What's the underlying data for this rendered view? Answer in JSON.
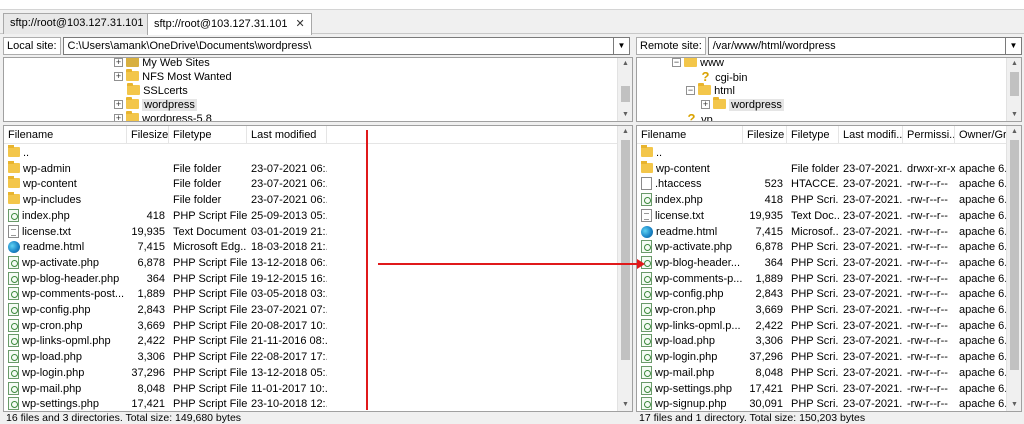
{
  "tabs": [
    {
      "label": "sftp://root@103.127.31.101",
      "active": false
    },
    {
      "label": "sftp://root@103.127.31.101",
      "active": true
    }
  ],
  "local": {
    "site_label": "Local site:",
    "path": "C:\\Users\\amank\\OneDrive\\Documents\\wordpress\\",
    "tree": [
      {
        "label": "My Web Sites",
        "icon": "special-folder-icon"
      },
      {
        "label": "NFS Most Wanted",
        "icon": "folder-icon"
      },
      {
        "label": "SSLcerts",
        "icon": "folder-icon"
      },
      {
        "label": "wordpress",
        "icon": "folder-icon"
      },
      {
        "label": "wordpress-5.8",
        "icon": "folder-icon"
      }
    ],
    "columns": [
      "Filename",
      "Filesize",
      "Filetype",
      "Last modified"
    ],
    "files": [
      {
        "name": "..",
        "size": "",
        "type": "",
        "modified": "",
        "icon": "folder"
      },
      {
        "name": "wp-admin",
        "size": "",
        "type": "File folder",
        "modified": "23-07-2021 06:...",
        "icon": "folder"
      },
      {
        "name": "wp-content",
        "size": "",
        "type": "File folder",
        "modified": "23-07-2021 06:...",
        "icon": "folder"
      },
      {
        "name": "wp-includes",
        "size": "",
        "type": "File folder",
        "modified": "23-07-2021 06:...",
        "icon": "folder"
      },
      {
        "name": "index.php",
        "size": "418",
        "type": "PHP Script File",
        "modified": "25-09-2013 05:...",
        "icon": "php"
      },
      {
        "name": "license.txt",
        "size": "19,935",
        "type": "Text Document",
        "modified": "03-01-2019 21:...",
        "icon": "txt"
      },
      {
        "name": "readme.html",
        "size": "7,415",
        "type": "Microsoft Edg...",
        "modified": "18-03-2018 21:...",
        "icon": "edge"
      },
      {
        "name": "wp-activate.php",
        "size": "6,878",
        "type": "PHP Script File",
        "modified": "13-12-2018 06:...",
        "icon": "php"
      },
      {
        "name": "wp-blog-header.php",
        "size": "364",
        "type": "PHP Script File",
        "modified": "19-12-2015 16:...",
        "icon": "php"
      },
      {
        "name": "wp-comments-post...",
        "size": "1,889",
        "type": "PHP Script File",
        "modified": "03-05-2018 03:...",
        "icon": "php"
      },
      {
        "name": "wp-config.php",
        "size": "2,843",
        "type": "PHP Script File",
        "modified": "23-07-2021 07:...",
        "icon": "php"
      },
      {
        "name": "wp-cron.php",
        "size": "3,669",
        "type": "PHP Script File",
        "modified": "20-08-2017 10:...",
        "icon": "php"
      },
      {
        "name": "wp-links-opml.php",
        "size": "2,422",
        "type": "PHP Script File",
        "modified": "21-11-2016 08:...",
        "icon": "php"
      },
      {
        "name": "wp-load.php",
        "size": "3,306",
        "type": "PHP Script File",
        "modified": "22-08-2017 17:...",
        "icon": "php"
      },
      {
        "name": "wp-login.php",
        "size": "37,296",
        "type": "PHP Script File",
        "modified": "13-12-2018 05:...",
        "icon": "php"
      },
      {
        "name": "wp-mail.php",
        "size": "8,048",
        "type": "PHP Script File",
        "modified": "11-01-2017 10:...",
        "icon": "php"
      },
      {
        "name": "wp-settings.php",
        "size": "17,421",
        "type": "PHP Script File",
        "modified": "23-10-2018 12:...",
        "icon": "php"
      }
    ],
    "status": "16 files and 3 directories. Total size: 149,680 bytes"
  },
  "remote": {
    "site_label": "Remote site:",
    "path": "/var/www/html/wordpress",
    "tree": [
      {
        "label": "www",
        "icon": "folder-icon"
      },
      {
        "label": "cgi-bin",
        "icon": "unknown-folder-icon"
      },
      {
        "label": "html",
        "icon": "folder-icon"
      },
      {
        "label": "wordpress",
        "icon": "folder-icon"
      },
      {
        "label": "vp",
        "icon": "unknown-folder-icon"
      }
    ],
    "columns": [
      "Filename",
      "Filesize",
      "Filetype",
      "Last modifi...",
      "Permissi...",
      "Owner/Gr..."
    ],
    "files": [
      {
        "name": "..",
        "size": "",
        "type": "",
        "modified": "",
        "perms": "",
        "owner": "",
        "icon": "folder"
      },
      {
        "name": "wp-content",
        "size": "",
        "type": "File folder",
        "modified": "23-07-2021...",
        "perms": "drwxr-xr-x",
        "owner": "apache 6...",
        "icon": "folder"
      },
      {
        "name": ".htaccess",
        "size": "523",
        "type": "HTACCE...",
        "modified": "23-07-2021...",
        "perms": "-rw-r--r--",
        "owner": "apache 6...",
        "icon": "blank"
      },
      {
        "name": "index.php",
        "size": "418",
        "type": "PHP Scri...",
        "modified": "23-07-2021...",
        "perms": "-rw-r--r--",
        "owner": "apache 6...",
        "icon": "php"
      },
      {
        "name": "license.txt",
        "size": "19,935",
        "type": "Text Doc...",
        "modified": "23-07-2021...",
        "perms": "-rw-r--r--",
        "owner": "apache 6...",
        "icon": "txt"
      },
      {
        "name": "readme.html",
        "size": "7,415",
        "type": "Microsof...",
        "modified": "23-07-2021...",
        "perms": "-rw-r--r--",
        "owner": "apache 6...",
        "icon": "edge"
      },
      {
        "name": "wp-activate.php",
        "size": "6,878",
        "type": "PHP Scri...",
        "modified": "23-07-2021...",
        "perms": "-rw-r--r--",
        "owner": "apache 6...",
        "icon": "php"
      },
      {
        "name": "wp-blog-header...",
        "size": "364",
        "type": "PHP Scri...",
        "modified": "23-07-2021...",
        "perms": "-rw-r--r--",
        "owner": "apache 6...",
        "icon": "php"
      },
      {
        "name": "wp-comments-p...",
        "size": "1,889",
        "type": "PHP Scri...",
        "modified": "23-07-2021...",
        "perms": "-rw-r--r--",
        "owner": "apache 6...",
        "icon": "php"
      },
      {
        "name": "wp-config.php",
        "size": "2,843",
        "type": "PHP Scri...",
        "modified": "23-07-2021...",
        "perms": "-rw-r--r--",
        "owner": "apache 6...",
        "icon": "php"
      },
      {
        "name": "wp-cron.php",
        "size": "3,669",
        "type": "PHP Scri...",
        "modified": "23-07-2021...",
        "perms": "-rw-r--r--",
        "owner": "apache 6...",
        "icon": "php"
      },
      {
        "name": "wp-links-opml.p...",
        "size": "2,422",
        "type": "PHP Scri...",
        "modified": "23-07-2021...",
        "perms": "-rw-r--r--",
        "owner": "apache 6...",
        "icon": "php"
      },
      {
        "name": "wp-load.php",
        "size": "3,306",
        "type": "PHP Scri...",
        "modified": "23-07-2021...",
        "perms": "-rw-r--r--",
        "owner": "apache 6...",
        "icon": "php"
      },
      {
        "name": "wp-login.php",
        "size": "37,296",
        "type": "PHP Scri...",
        "modified": "23-07-2021...",
        "perms": "-rw-r--r--",
        "owner": "apache 6...",
        "icon": "php"
      },
      {
        "name": "wp-mail.php",
        "size": "8,048",
        "type": "PHP Scri...",
        "modified": "23-07-2021...",
        "perms": "-rw-r--r--",
        "owner": "apache 6...",
        "icon": "php"
      },
      {
        "name": "wp-settings.php",
        "size": "17,421",
        "type": "PHP Scri...",
        "modified": "23-07-2021...",
        "perms": "-rw-r--r--",
        "owner": "apache 6...",
        "icon": "php"
      },
      {
        "name": "wp-signup.php",
        "size": "30,091",
        "type": "PHP Scri...",
        "modified": "23-07-2021...",
        "perms": "-rw-r--r--",
        "owner": "apache 6...",
        "icon": "php"
      }
    ],
    "status": "17 files and 1 directory. Total size: 150,203 bytes"
  },
  "annotations": {
    "color": "#e0191b"
  }
}
